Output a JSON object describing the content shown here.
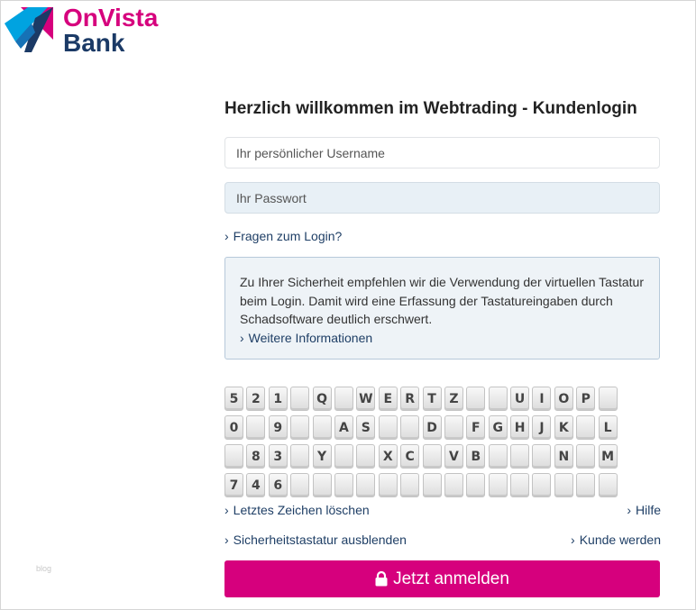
{
  "logo": {
    "line1": "OnVista",
    "line2": "Bank",
    "colors": {
      "magenta": "#d6007d",
      "navy": "#1b3a66",
      "cyan": "#00a3e0"
    }
  },
  "watermark": "blog",
  "login": {
    "title": "Herzlich willkommen im Webtrading - Kundenlogin",
    "username_placeholder": "Ihr persönlicher Username",
    "password_placeholder": "Ihr Passwort",
    "faq_link": "Fragen zum Login?",
    "info_text": "Zu Ihrer Sicherheit empfehlen wir die Verwendung der virtuellen Tastatur beim Login. Damit wird eine Erfassung der Tastatureingaben durch Schadsoftware deutlich erschwert.",
    "info_link": "Weitere Informationen",
    "submit_label": "Jetzt anmelden",
    "accent_color": "#d6007d"
  },
  "keyboard": {
    "rows": [
      [
        "5",
        "2",
        "1",
        "",
        "Q",
        "",
        "W",
        "E",
        "R",
        "T",
        "Z",
        "",
        "",
        "U",
        "I",
        "O",
        "P",
        ""
      ],
      [
        "0",
        "",
        "9",
        "",
        "",
        "A",
        "S",
        "",
        "",
        "D",
        "",
        "F",
        "G",
        "H",
        "J",
        "K",
        "",
        "L"
      ],
      [
        "",
        "8",
        "3",
        "",
        "Y",
        "",
        "",
        "X",
        "C",
        "",
        "V",
        "B",
        "",
        "",
        "",
        "N",
        "",
        "M"
      ],
      [
        "7",
        "4",
        "6",
        "",
        "",
        "",
        "",
        "",
        "",
        "",
        "",
        "",
        "",
        "",
        "",
        "",
        "",
        ""
      ]
    ]
  },
  "keyboard_links": {
    "delete_last": "Letztes Zeichen löschen",
    "help": "Hilfe",
    "hide_keyboard": "Sicherheitstastatur ausblenden",
    "become_customer": "Kunde werden"
  }
}
